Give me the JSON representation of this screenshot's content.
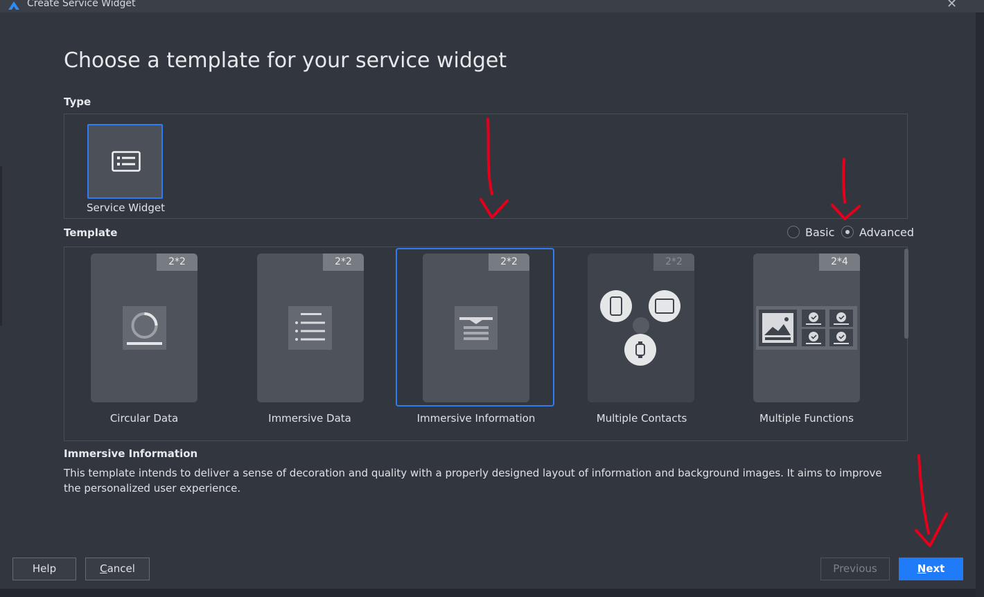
{
  "window": {
    "title": "Create Service Widget"
  },
  "heading": "Choose a template for your service widget",
  "type_section": {
    "label": "Type",
    "items": [
      {
        "label": "Service Widget",
        "icon": "list-card-icon"
      }
    ]
  },
  "template_section": {
    "label": "Template",
    "modes": [
      {
        "label": "Basic",
        "checked": false
      },
      {
        "label": "Advanced",
        "checked": true
      }
    ],
    "templates": [
      {
        "label": "Circular Data",
        "size": "2*2",
        "icon": "circular-progress-icon"
      },
      {
        "label": "Immersive Data",
        "size": "2*2",
        "icon": "list-lines-icon"
      },
      {
        "label": "Immersive Information",
        "size": "2*2",
        "icon": "text-block-icon",
        "selected": true
      },
      {
        "label": "Multiple Contacts",
        "size": "2*2",
        "icon": "devices-icon"
      },
      {
        "label": "Multiple Functions",
        "size": "2*4",
        "icon": "image-grid-icon"
      }
    ]
  },
  "description": {
    "title": "Immersive Information",
    "text": "This template intends to deliver a sense of decoration and quality with a properly designed layout of information and background images. It aims to improve the personalized user experience."
  },
  "buttons": {
    "help": "Help",
    "cancel_prefix": "C",
    "cancel_rest": "ancel",
    "previous": "Previous",
    "next_prefix": "N",
    "next_rest": "ext"
  },
  "colors": {
    "accent": "#1f7bf7",
    "background": "#32363f",
    "annotation": "#e4001b"
  }
}
